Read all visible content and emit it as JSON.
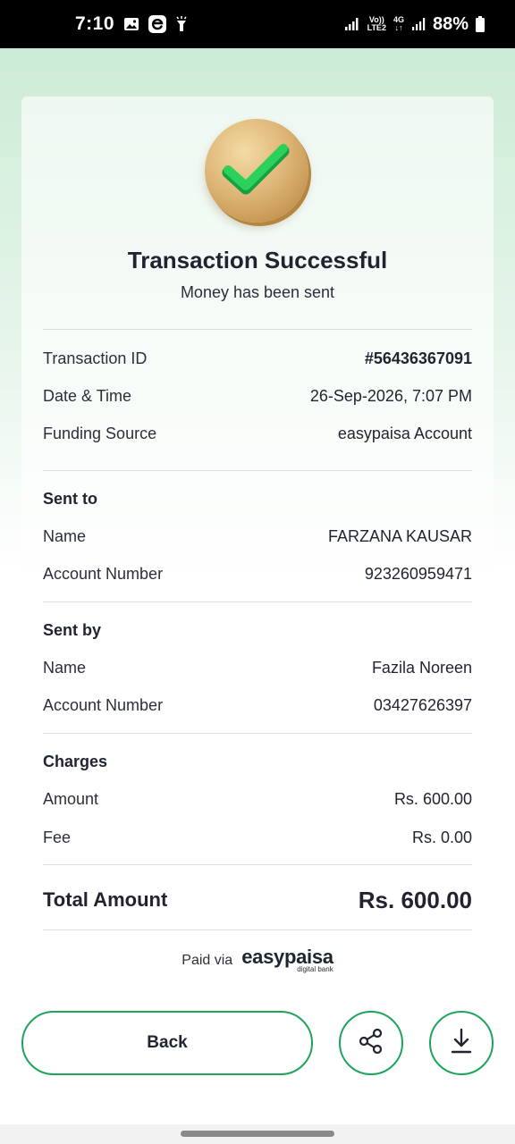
{
  "status_bar": {
    "time": "7:10",
    "network_top": "Vo))",
    "network_bottom": "LTE2",
    "gen_top": "4G",
    "battery": "88%"
  },
  "receipt": {
    "title": "Transaction Successful",
    "subtitle": "Money has been sent",
    "details": [
      {
        "label": "Transaction ID",
        "value": "#56436367091"
      },
      {
        "label": "Date & Time",
        "value": "26-Sep-2026, 7:07 PM"
      },
      {
        "label": "Funding Source",
        "value": "easypaisa Account"
      }
    ],
    "sent_to": {
      "heading": "Sent to",
      "name_label": "Name",
      "name_value": "FARZANA KAUSAR",
      "account_label": "Account Number",
      "account_value": "923260959471"
    },
    "sent_by": {
      "heading": "Sent by",
      "name_label": "Name",
      "name_value": "Fazila Noreen",
      "account_label": "Account Number",
      "account_value": "03427626397"
    },
    "charges": {
      "heading": "Charges",
      "amount_label": "Amount",
      "amount_value": "Rs. 600.00",
      "fee_label": "Fee",
      "fee_value": "Rs. 0.00"
    },
    "total": {
      "label": "Total Amount",
      "value": "Rs. 600.00"
    },
    "paid_via": {
      "text": "Paid via",
      "brand": "easypaisa",
      "brand_sub": "digital bank"
    }
  },
  "actions": {
    "back_label": "Back",
    "share_icon": "share-icon",
    "download_icon": "download-icon"
  },
  "colors": {
    "accent_green": "#1ea35a",
    "check_green": "#22c04d",
    "coin_gold": "#deb677"
  }
}
